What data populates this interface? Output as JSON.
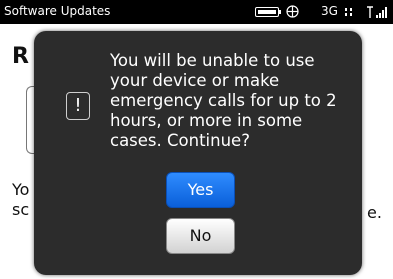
{
  "status_bar": {
    "title": "Software Updates",
    "network_label": "3G",
    "icons": [
      "battery-icon",
      "globe-icon",
      "data-arrows-icon",
      "signal-strength-icon"
    ]
  },
  "background": {
    "heading": "R",
    "box_glyph": "=",
    "line1_fragment": "Yo",
    "line2_fragment": "sc",
    "line2_end": "e."
  },
  "dialog": {
    "icon": "alert-icon",
    "icon_glyph": "!",
    "message": "You will be unable to use your device or make emergency calls for up to 2 hours, or more in some cases. Continue?",
    "yes_label": "Yes",
    "no_label": "No"
  },
  "colors": {
    "dialog_background": "#2c2c2c",
    "yes_button": "#1a73e8",
    "no_button": "#e6e6e6",
    "status_bar": "#000000"
  }
}
